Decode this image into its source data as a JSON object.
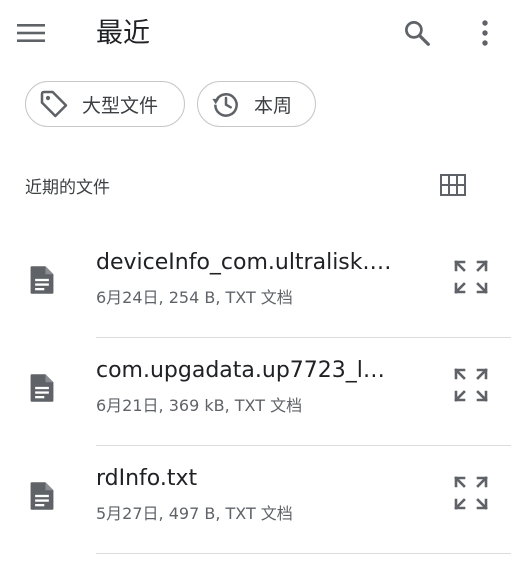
{
  "appbar": {
    "title": "最近",
    "icons": {
      "menu": "menu-icon",
      "search": "search-icon",
      "more": "more-vert-icon"
    }
  },
  "chips": [
    {
      "label": "大型文件",
      "icon": "tag-icon"
    },
    {
      "label": "本周",
      "icon": "history-icon"
    }
  ],
  "section": {
    "title": "近期的文件",
    "view_toggle_icon": "grid-view-icon"
  },
  "files": [
    {
      "name": "deviceInfo_com.ultralisk.g...",
      "meta": "6月24日, 254 B, TXT 文档",
      "icon": "document-icon"
    },
    {
      "name": "com.upgadata.up7723_lo...",
      "meta": "6月21日, 369 kB, TXT 文档",
      "icon": "document-icon"
    },
    {
      "name": "rdInfo.txt",
      "meta": "5月27日, 497 B, TXT 文档",
      "icon": "document-icon"
    }
  ],
  "colors": {
    "icon": "#5f6368",
    "text": "#202124",
    "secondary_text": "#5f6368",
    "divider": "#dadce0",
    "chip_border": "#c7c7c7"
  }
}
